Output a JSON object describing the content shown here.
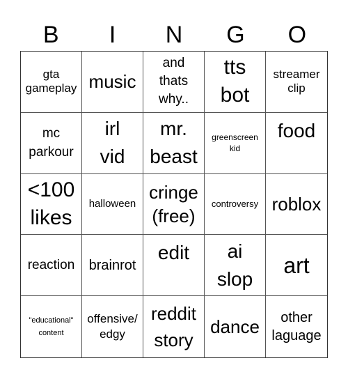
{
  "header": [
    "B",
    "I",
    "N",
    "G",
    "O"
  ],
  "cells": [
    "gta\ngameplay",
    "music",
    "and\nthats\nwhy..",
    "tts\nbot",
    "streamer\nclip",
    "mc\nparkour",
    "irl\nvid",
    "mr.\nbeast",
    "greenscreen\nkid",
    "food",
    "<100\nlikes",
    "halloween",
    "cringe\n(free)",
    "controversy",
    "roblox",
    "reaction",
    "brainrot",
    "edit",
    "ai\nslop",
    "art",
    "\"educational\"\ncontent",
    "offensive/\nedgy",
    "reddit\nstory",
    "dance",
    "other\nlaguage"
  ]
}
